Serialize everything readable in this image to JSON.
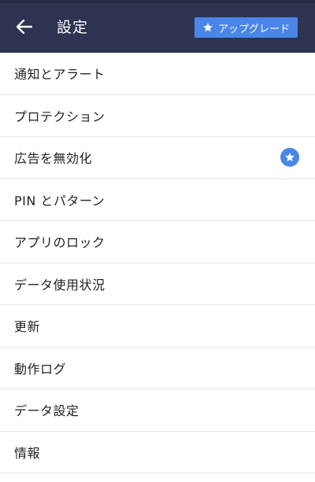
{
  "header": {
    "title": "設定",
    "back_icon": "arrow-left-icon",
    "upgrade_label": "アップグレード",
    "upgrade_icon": "star-icon"
  },
  "colors": {
    "header_bg": "#2d3350",
    "accent": "#4a86e8",
    "text": "#222222",
    "divider": "#e6e6e6"
  },
  "menu": {
    "items": [
      {
        "label": "通知とアラート"
      },
      {
        "label": "プロテクション"
      },
      {
        "label": "広告を無効化",
        "badge_icon": "premium-star-icon"
      },
      {
        "label": "PIN とパターン"
      },
      {
        "label": "アプリのロック"
      },
      {
        "label": "データ使用状況"
      },
      {
        "label": "更新"
      },
      {
        "label": "動作ログ"
      },
      {
        "label": "データ設定"
      },
      {
        "label": "情報"
      }
    ]
  }
}
